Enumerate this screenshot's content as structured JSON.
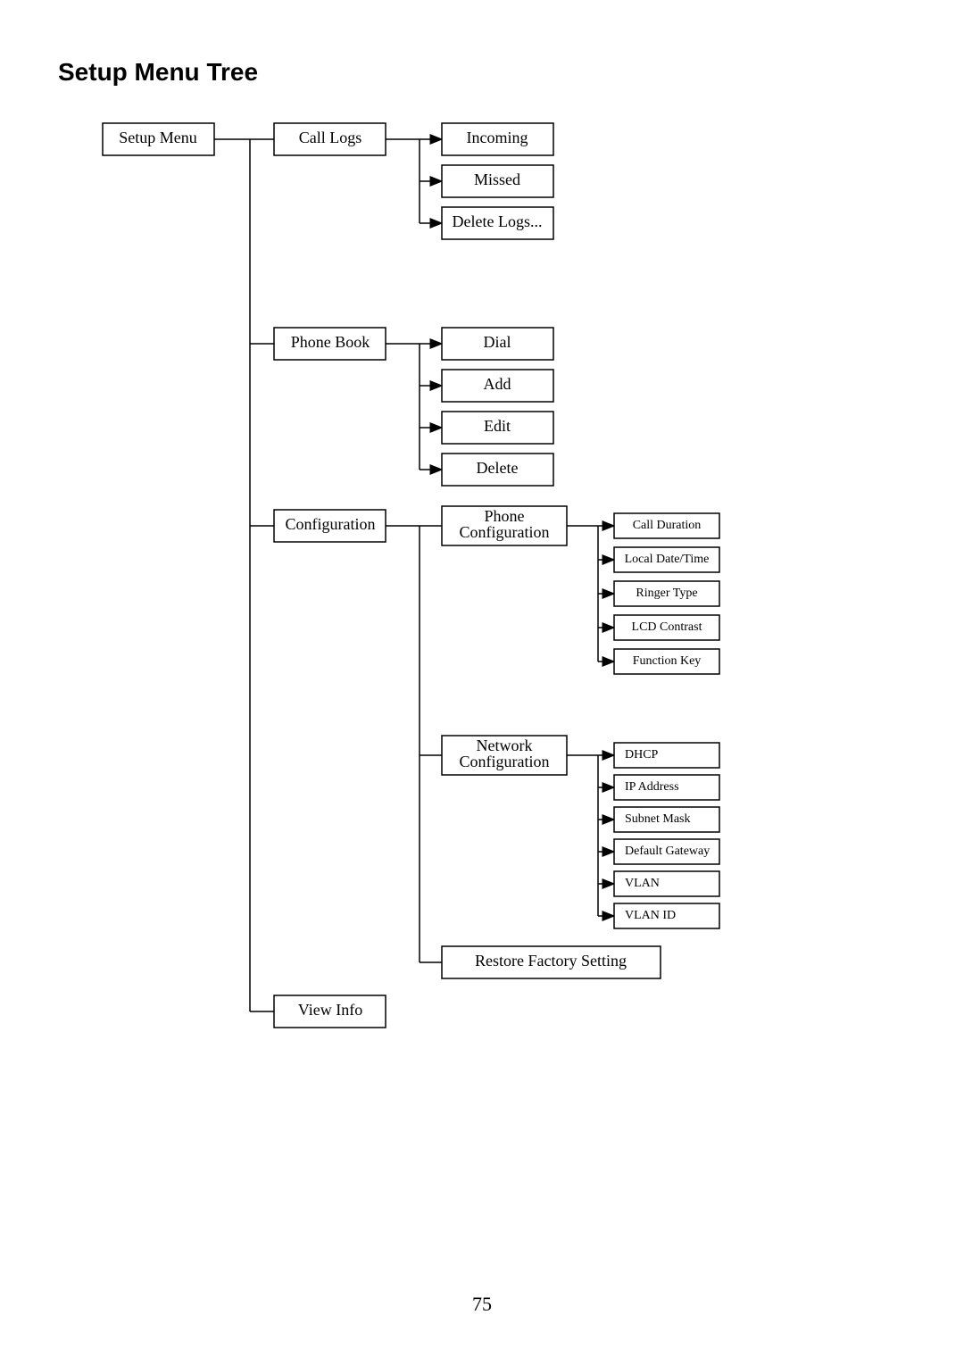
{
  "title": "Setup Menu Tree",
  "page": "75",
  "root": "Setup Menu",
  "level1": {
    "calllogs": "Call Logs",
    "phonebook": "Phone Book",
    "config": "Configuration",
    "viewinfo": "View Info"
  },
  "calllogs_children": {
    "incoming": "Incoming",
    "missed": "Missed",
    "deletelogs": "Delete Logs..."
  },
  "phonebook_children": {
    "dial": "Dial",
    "add": "Add",
    "edit": "Edit",
    "delete": "Delete"
  },
  "config_children": {
    "phoneconf_l1": "Phone",
    "phoneconf_l2": "Configuration",
    "netconf_l1": "Network",
    "netconf_l2": "Configuration",
    "restore": "Restore Factory Setting"
  },
  "phoneconf_children": {
    "callduration": "Call Duration",
    "localdatetime": "Local Date/Time",
    "ringertype": "Ringer Type",
    "lcdcontrast": "LCD Contrast",
    "functionkey": "Function Key"
  },
  "netconf_children": {
    "dhcp": "DHCP",
    "ipaddress": "IP Address",
    "subnet": "Subnet Mask",
    "gateway": "Default Gateway",
    "vlan": "VLAN",
    "vlanid": "VLAN ID"
  }
}
